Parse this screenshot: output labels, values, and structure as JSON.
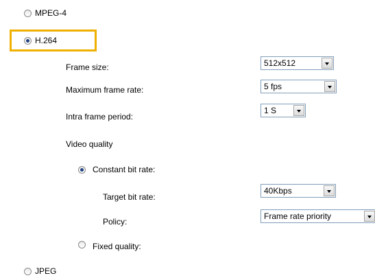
{
  "codec_options": {
    "mpeg4": {
      "label": "MPEG-4",
      "selected": false
    },
    "h264": {
      "label": "H.264",
      "selected": true
    },
    "jpeg": {
      "label": "JPEG",
      "selected": false
    }
  },
  "h264_settings": {
    "frame_size": {
      "label": "Frame size:",
      "value": "512x512"
    },
    "max_frame_rate": {
      "label": "Maximum frame rate:",
      "value": "5 fps"
    },
    "intra_frame_period": {
      "label": "Intra frame period:",
      "value": "1 S"
    },
    "video_quality": {
      "label": "Video quality",
      "constant_bit_rate": {
        "label": "Constant bit rate:",
        "selected": true
      },
      "target_bit_rate": {
        "label": "Target bit rate:",
        "value": "40Kbps"
      },
      "policy": {
        "label": "Policy:",
        "value": "Frame rate priority"
      },
      "fixed_quality": {
        "label": "Fixed quality:",
        "selected": false
      }
    }
  },
  "colors": {
    "highlight": "#f0b000",
    "radio_dot": "#1e3f80"
  }
}
